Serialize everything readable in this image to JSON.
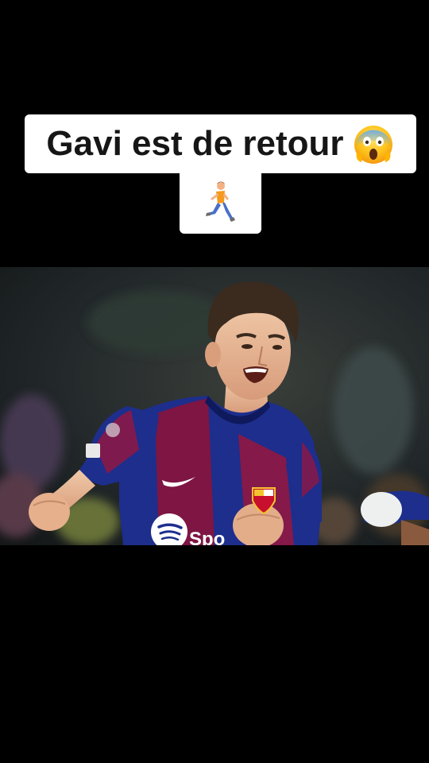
{
  "caption": {
    "text": "Gavi est de retour",
    "emoji_1": "screaming-face",
    "emoji_2": "running-person"
  },
  "photo": {
    "subject": "footballer-in-barcelona-kit",
    "crest_text": "FCB",
    "sponsor_text": "Spo"
  },
  "colors": {
    "background": "#000000",
    "caption_bg": "#ffffff",
    "caption_text": "#161616",
    "kit_blue": "#1d2e8c",
    "kit_red": "#a0143a"
  }
}
